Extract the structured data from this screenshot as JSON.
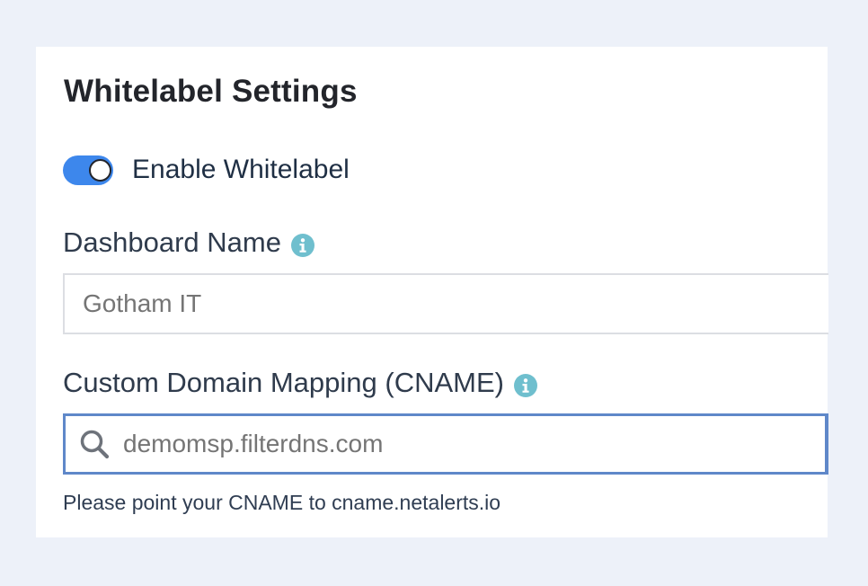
{
  "card": {
    "title": "Whitelabel Settings"
  },
  "whitelabel_toggle": {
    "label": "Enable Whitelabel",
    "enabled": true
  },
  "dashboard_name": {
    "label": "Dashboard Name",
    "info_icon": "info-circle-icon",
    "placeholder": "Gotham IT",
    "value": ""
  },
  "custom_domain": {
    "label": "Custom Domain Mapping (CNAME)",
    "info_icon": "info-circle-icon",
    "search_icon": "search-icon",
    "placeholder": "demomsp.filterdns.com",
    "value": "",
    "help_text": "Please point your CNAME to cname.netalerts.io"
  },
  "colors": {
    "page_background": "#edf1f9",
    "card_background": "#ffffff",
    "toggle_on": "#3d87ec",
    "info_icon": "#6fbfce",
    "focused_input_border": "#5f88c9"
  }
}
